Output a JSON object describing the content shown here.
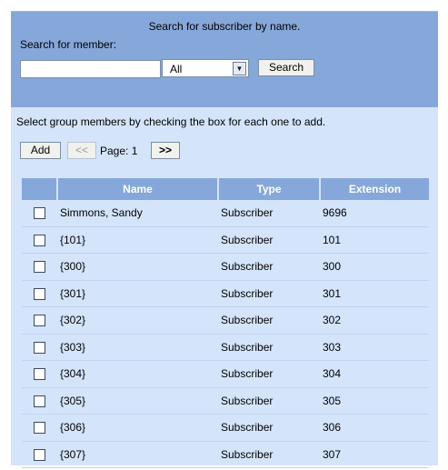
{
  "search": {
    "title": "Search for subscriber by name.",
    "label": "Search for member:",
    "input_value": "",
    "type_value": "All",
    "button_label": "Search"
  },
  "instructions": "Select group members by checking the box for each one to add.",
  "pager": {
    "add_label": "Add",
    "prev_label": "<<",
    "page_label": "Page: 1",
    "next_label": ">>"
  },
  "table": {
    "columns": [
      "",
      "Name",
      "Type",
      "Extension"
    ],
    "rows": [
      {
        "name": "Simmons, Sandy",
        "type": "Subscriber",
        "ext": "9696"
      },
      {
        "name": "{101}",
        "type": "Subscriber",
        "ext": "101"
      },
      {
        "name": "{300}",
        "type": "Subscriber",
        "ext": "300"
      },
      {
        "name": "{301}",
        "type": "Subscriber",
        "ext": "301"
      },
      {
        "name": "{302}",
        "type": "Subscriber",
        "ext": "302"
      },
      {
        "name": "{303}",
        "type": "Subscriber",
        "ext": "303"
      },
      {
        "name": "{304}",
        "type": "Subscriber",
        "ext": "304"
      },
      {
        "name": "{305}",
        "type": "Subscriber",
        "ext": "305"
      },
      {
        "name": "{306}",
        "type": "Subscriber",
        "ext": "306"
      },
      {
        "name": "{307}",
        "type": "Subscriber",
        "ext": "307"
      }
    ]
  },
  "colors": {
    "panel": "#86a7d9",
    "background": "#d4e4fb"
  }
}
